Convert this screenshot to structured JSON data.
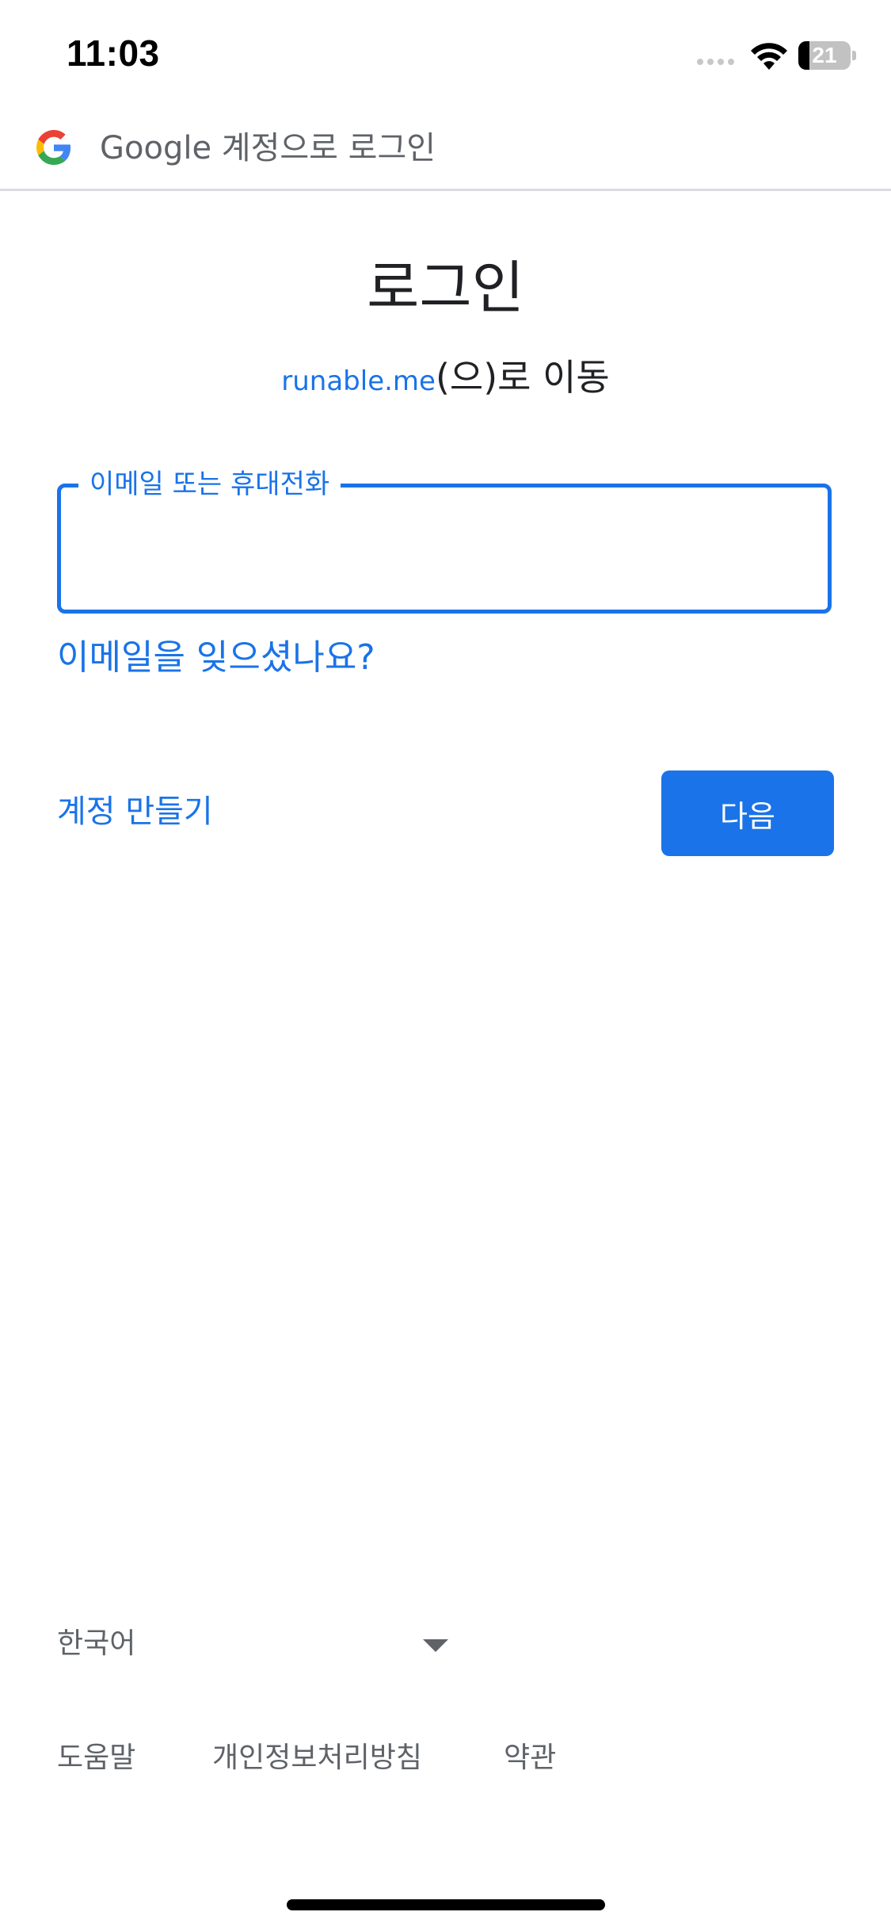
{
  "status_bar": {
    "time": "11:03",
    "battery_level": "21",
    "battery_fraction": 0.21
  },
  "header": {
    "title": "Google 계정으로 로그인",
    "logo_icon": "google-g-logo"
  },
  "main": {
    "title": "로그인",
    "subtitle_link": "runable.me",
    "subtitle_rest": "(으)로 이동",
    "email_field": {
      "label": "이메일 또는 휴대전화",
      "value": ""
    },
    "forgot_email": "이메일을 잊으셨나요?",
    "create_account": "계정 만들기",
    "next_button": "다음"
  },
  "footer": {
    "language": "한국어",
    "links": {
      "help": "도움말",
      "privacy": "개인정보처리방침",
      "terms": "약관"
    }
  },
  "colors": {
    "accent": "#1a73e8",
    "text_secondary": "#5f6368",
    "divider": "#dadce0"
  }
}
